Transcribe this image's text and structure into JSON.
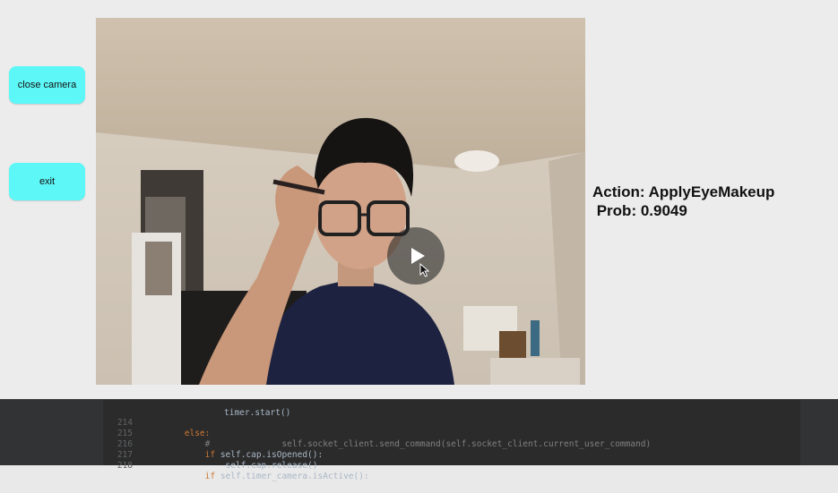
{
  "buttons": {
    "close_camera": "close camera",
    "exit": "exit"
  },
  "result": {
    "action_line": "Action: ApplyEyeMakeup",
    "prob_line": " Prob: 0.9049"
  },
  "code": {
    "partial_top": "timer.start()",
    "lines": [
      {
        "num": "214",
        "indent": "        ",
        "keyword": "else:",
        "rest": ""
      },
      {
        "num": "215",
        "indent": "            ",
        "keyword": "",
        "rest": "#              self.socket_client.send_command(self.socket_client.current_user_command)"
      },
      {
        "num": "216",
        "indent": "            ",
        "keyword": "if ",
        "rest": "self.cap.isOpened():"
      },
      {
        "num": "217",
        "indent": "                ",
        "keyword": "",
        "rest": "self.cap.release()"
      },
      {
        "num": "218",
        "indent": "            ",
        "keyword": "if ",
        "rest": "self.timer_camera.isActive():"
      }
    ]
  },
  "colors": {
    "button_bg": "#5ef7f7",
    "window_bg": "#ececec",
    "editor_bg": "#2b2b2b"
  }
}
